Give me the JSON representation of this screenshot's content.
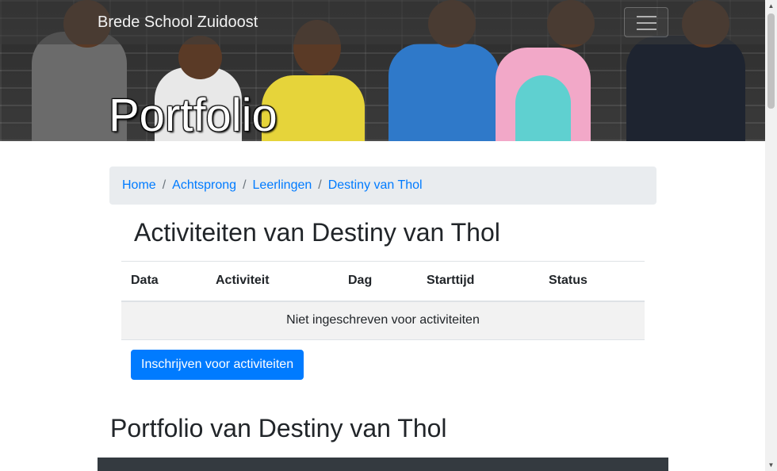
{
  "navbar": {
    "brand": "Brede School Zuidoost",
    "toggler_icon": "hamburger-menu-icon"
  },
  "hero": {
    "title": "Portfolio"
  },
  "breadcrumb": {
    "items": [
      "Home",
      "Achtsprong",
      "Leerlingen",
      "Destiny van Thol"
    ],
    "separator": "/"
  },
  "activities": {
    "heading": "Activiteiten van Destiny van Thol",
    "columns": [
      "Data",
      "Activiteit",
      "Dag",
      "Starttijd",
      "Status"
    ],
    "empty_message": "Niet ingeschreven voor activiteiten",
    "enroll_button": "Inschrijven voor activiteiten"
  },
  "portfolio": {
    "heading": "Portfolio van Destiny van Thol"
  },
  "colors": {
    "link": "#007bff",
    "button": "#007bff",
    "breadcrumb_bg": "#e9ecef",
    "empty_row_bg": "#f2f2f2",
    "dark_panel": "#343a40"
  }
}
